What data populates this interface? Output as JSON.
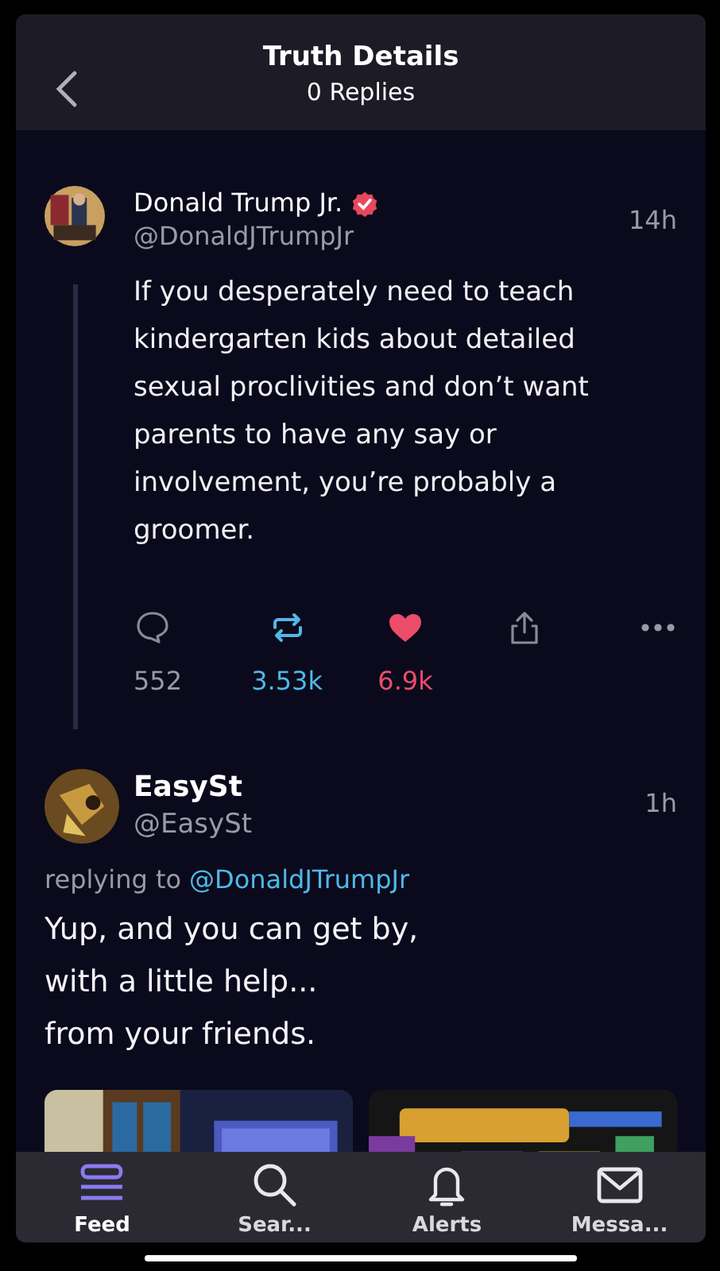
{
  "header": {
    "title": "Truth Details",
    "subtitle": "0 Replies"
  },
  "posts": [
    {
      "author": "Donald Trump Jr.",
      "verified": true,
      "handle": "@DonaldJTrumpJr",
      "time": "14h",
      "text": "If you desperately need to teach kindergarten kids about detailed sexual proclivities and don’t want parents to have any say or involvement, you’re probably a groomer.",
      "thread_line": true,
      "actions": {
        "replies": "552",
        "reposts": "3.53k",
        "likes": "6.9k",
        "reposted": true,
        "liked": true
      }
    },
    {
      "author": "EasySt",
      "verified": false,
      "handle": "@EasySt",
      "time": "1h",
      "replying_prefix": "replying to",
      "replying_to": "@DonaldJTrumpJr",
      "text": "Yup, and you can get by,\nwith a little help...\nfrom your friends.",
      "thread_line": false
    }
  ],
  "tabs": [
    {
      "label": "Feed",
      "selected": true
    },
    {
      "label": "Sear...",
      "selected": false
    },
    {
      "label": "Alerts",
      "selected": false
    },
    {
      "label": "Messa...",
      "selected": false
    }
  ]
}
